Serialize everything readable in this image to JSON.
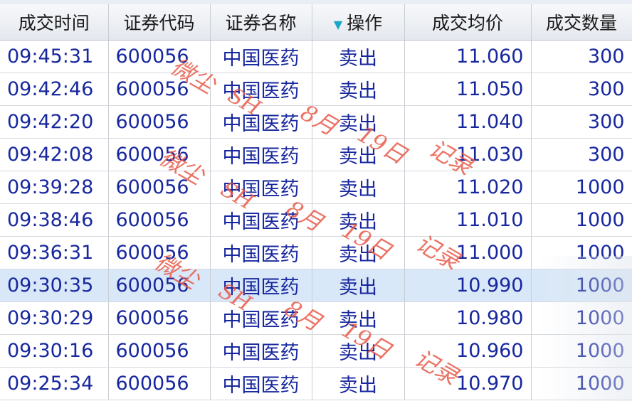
{
  "columns": [
    {
      "key": "time",
      "label": "成交时间"
    },
    {
      "key": "code",
      "label": "证券代码"
    },
    {
      "key": "name",
      "label": "证券名称"
    },
    {
      "key": "action",
      "label": "操作"
    },
    {
      "key": "price",
      "label": "成交均价"
    },
    {
      "key": "qty",
      "label": "成交数量"
    }
  ],
  "rows": [
    {
      "time": "09:45:31",
      "code": "600056",
      "name": "中国医药",
      "action": "卖出",
      "price": "11.060",
      "qty": "300"
    },
    {
      "time": "09:42:46",
      "code": "600056",
      "name": "中国医药",
      "action": "卖出",
      "price": "11.050",
      "qty": "300"
    },
    {
      "time": "09:42:20",
      "code": "600056",
      "name": "中国医药",
      "action": "卖出",
      "price": "11.040",
      "qty": "300"
    },
    {
      "time": "09:42:08",
      "code": "600056",
      "name": "中国医药",
      "action": "卖出",
      "price": "11.030",
      "qty": "300"
    },
    {
      "time": "09:39:28",
      "code": "600056",
      "name": "中国医药",
      "action": "卖出",
      "price": "11.020",
      "qty": "1000"
    },
    {
      "time": "09:38:46",
      "code": "600056",
      "name": "中国医药",
      "action": "卖出",
      "price": "11.010",
      "qty": "1000"
    },
    {
      "time": "09:36:31",
      "code": "600056",
      "name": "中国医药",
      "action": "卖出",
      "price": "11.000",
      "qty": "1000"
    },
    {
      "time": "09:30:35",
      "code": "600056",
      "name": "中国医药",
      "action": "卖出",
      "price": "10.990",
      "qty": "1000"
    },
    {
      "time": "09:30:29",
      "code": "600056",
      "name": "中国医药",
      "action": "卖出",
      "price": "10.980",
      "qty": "1000"
    },
    {
      "time": "09:30:16",
      "code": "600056",
      "name": "中国医药",
      "action": "卖出",
      "price": "10.960",
      "qty": "1000"
    },
    {
      "time": "09:25:34",
      "code": "600056",
      "name": "中国医药",
      "action": "卖出",
      "price": "10.970",
      "qty": "1000"
    }
  ],
  "selected_row_index": 7,
  "sort_icon": "sort-down-triangle-icon",
  "colors": {
    "text": "#17279e",
    "selected_row": "#d9e8f8",
    "sort_arrow": "#1aa6c8",
    "watermark": "#e85a4a"
  },
  "watermark": {
    "parts": [
      "微尘",
      "SH",
      "8月",
      "19日",
      "记录"
    ]
  }
}
